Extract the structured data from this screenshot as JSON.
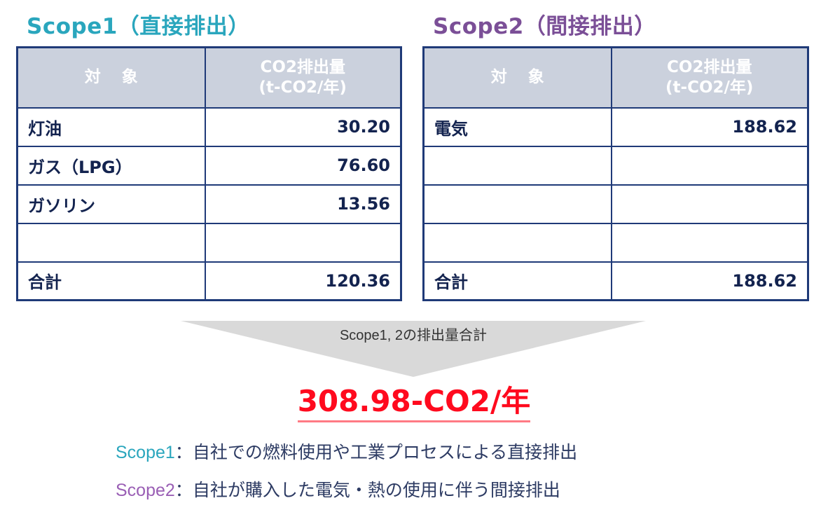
{
  "scope1": {
    "title": "Scope1（直接排出）",
    "header": {
      "target": "対象",
      "amount_line1": "CO2排出量",
      "amount_line2": "(t-CO2/年)"
    },
    "rows": [
      {
        "name": "灯油",
        "value": "30.20"
      },
      {
        "name": "ガス（LPG）",
        "value": "76.60"
      },
      {
        "name": "ガソリン",
        "value": "13.56"
      },
      {
        "name": "",
        "value": ""
      }
    ],
    "total": {
      "name": "合計",
      "value": "120.36"
    }
  },
  "scope2": {
    "title": "Scope2（間接排出）",
    "header": {
      "target": "対象",
      "amount_line1": "CO2排出量",
      "amount_line2": "(t-CO2/年)"
    },
    "rows": [
      {
        "name": "電気",
        "value": "188.62"
      },
      {
        "name": "",
        "value": ""
      },
      {
        "name": "",
        "value": ""
      },
      {
        "name": "",
        "value": ""
      }
    ],
    "total": {
      "name": "合計",
      "value": "188.62"
    }
  },
  "summary": {
    "arrow_label": "Scope1, 2の排出量合計",
    "total": "308.98-CO2/年"
  },
  "definitions": [
    {
      "key": "Scope1",
      "sep": "：",
      "text": "自社での燃料使用や工業プロセスによる直接排出"
    },
    {
      "key": "Scope2",
      "sep": "：",
      "text": "自社が購入した電気・熱の使用に伴う間接排出"
    }
  ],
  "colors": {
    "scope1": "#2aa6bd",
    "scope2": "#7b4f97",
    "table_border": "#1f3a78",
    "header_bg": "#cbd1dd",
    "total_red": "#ff0a1e"
  }
}
